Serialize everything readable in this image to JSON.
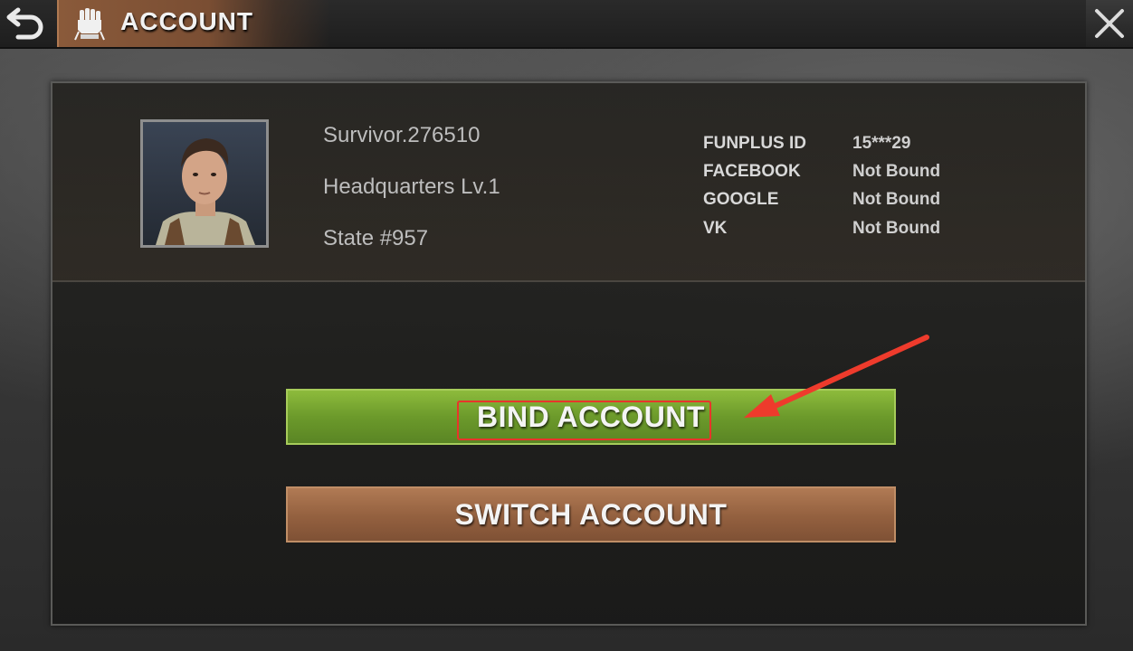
{
  "header": {
    "title": "ACCOUNT",
    "back_icon": "back-arrow-icon",
    "title_icon": "fist-icon",
    "close_icon": "close-icon"
  },
  "profile": {
    "name": "Survivor.276510",
    "headquarters": "Headquarters Lv.1",
    "state": "State #957"
  },
  "accounts": [
    {
      "label": "FUNPLUS ID",
      "value": "15***29"
    },
    {
      "label": "FACEBOOK",
      "value": "Not Bound"
    },
    {
      "label": "GOOGLE",
      "value": "Not Bound"
    },
    {
      "label": "VK",
      "value": "Not Bound"
    }
  ],
  "buttons": {
    "bind": "BIND ACCOUNT",
    "switch": "SWITCH ACCOUNT"
  },
  "colors": {
    "bind_button": "#6c9a2b",
    "switch_button": "#93603f",
    "annotation": "#e8352a"
  }
}
